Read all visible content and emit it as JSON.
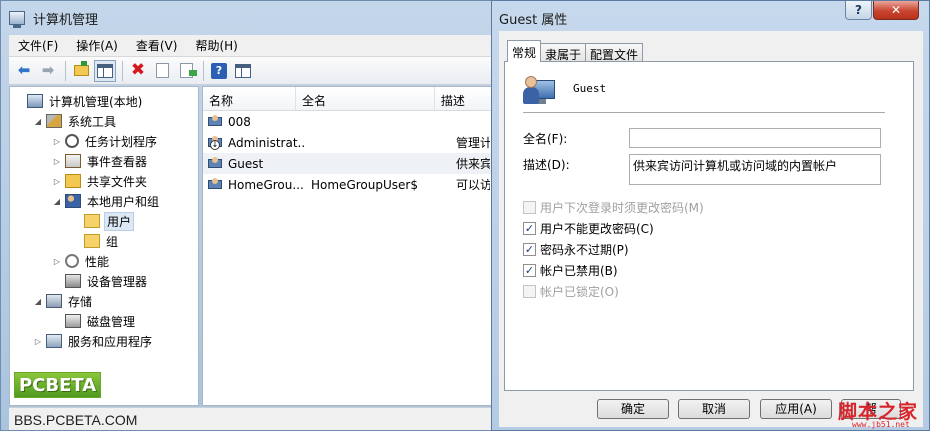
{
  "main_window": {
    "title": "计算机管理",
    "menu": [
      "文件(F)",
      "操作(A)",
      "查看(V)",
      "帮助(H)"
    ],
    "toolbar_icons": [
      "back-arrow-icon",
      "forward-arrow-icon",
      "up-folder-icon",
      "show-hide-tree-icon",
      "delete-icon",
      "properties-icon",
      "export-icon",
      "help-icon",
      "action-pane-icon"
    ],
    "tree": [
      {
        "label": "计算机管理(本地)",
        "depth": 0,
        "twisty": "",
        "icon": "computer-icon"
      },
      {
        "label": "系统工具",
        "depth": 1,
        "twisty": "◢",
        "icon": "tools-icon"
      },
      {
        "label": "任务计划程序",
        "depth": 2,
        "twisty": "▷",
        "icon": "clock-icon"
      },
      {
        "label": "事件查看器",
        "depth": 2,
        "twisty": "▷",
        "icon": "event-viewer-icon"
      },
      {
        "label": "共享文件夹",
        "depth": 2,
        "twisty": "▷",
        "icon": "shared-folder-icon"
      },
      {
        "label": "本地用户和组",
        "depth": 2,
        "twisty": "◢",
        "icon": "users-icon"
      },
      {
        "label": "用户",
        "depth": 3,
        "twisty": "",
        "icon": "folder-icon",
        "selected": true
      },
      {
        "label": "组",
        "depth": 3,
        "twisty": "",
        "icon": "folder-icon"
      },
      {
        "label": "性能",
        "depth": 2,
        "twisty": "▷",
        "icon": "performance-icon"
      },
      {
        "label": "设备管理器",
        "depth": 2,
        "twisty": "",
        "icon": "device-manager-icon"
      },
      {
        "label": "存储",
        "depth": 1,
        "twisty": "◢",
        "icon": "storage-icon"
      },
      {
        "label": "磁盘管理",
        "depth": 2,
        "twisty": "",
        "icon": "disk-icon"
      },
      {
        "label": "服务和应用程序",
        "depth": 1,
        "twisty": "▷",
        "icon": "services-icon"
      }
    ],
    "list_columns": [
      "名称",
      "全名",
      "描述"
    ],
    "list_rows": [
      {
        "name": "008",
        "fullname": "",
        "desc": ""
      },
      {
        "name": "Administrat...",
        "fullname": "",
        "desc": "管理计"
      },
      {
        "name": "Guest",
        "fullname": "",
        "desc": "供来宾"
      },
      {
        "name": "HomeGrou...",
        "fullname": "HomeGroupUser$",
        "desc": "可以访"
      }
    ]
  },
  "watermark": {
    "logo": "PCBETA",
    "url": "BBS.PCBETA.COM"
  },
  "dialog": {
    "title": "Guest 属性",
    "help_btn": "?",
    "close_btn": "✕",
    "tabs": [
      "常规",
      "隶属于",
      "配置文件"
    ],
    "user_name": "Guest",
    "fullname_label": "全名(F):",
    "fullname_value": "",
    "desc_label": "描述(D):",
    "desc_value": "供来宾访问计算机或访问域的内置帐户",
    "checkboxes": [
      {
        "label": "用户下次登录时须更改密码(M)",
        "checked": false,
        "disabled": true
      },
      {
        "label": "用户不能更改密码(C)",
        "checked": true,
        "disabled": false
      },
      {
        "label": "密码永不过期(P)",
        "checked": true,
        "disabled": false
      },
      {
        "label": "帐户已禁用(B)",
        "checked": true,
        "disabled": false
      },
      {
        "label": "帐户已锁定(O)",
        "checked": false,
        "disabled": true
      }
    ],
    "buttons": {
      "ok": "确定",
      "cancel": "取消",
      "apply": "应用(A)",
      "help": "帮"
    }
  },
  "corner_watermark": {
    "text": "脚本之家",
    "url": "www.jb51.net"
  }
}
